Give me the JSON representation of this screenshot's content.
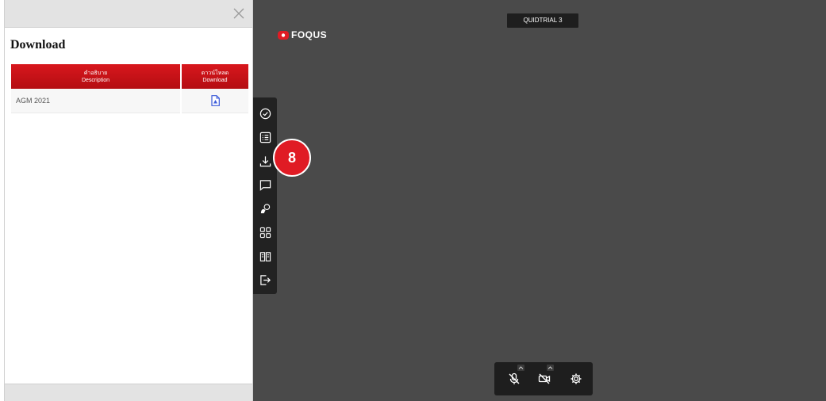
{
  "panel": {
    "title": "Download",
    "close_icon": "close-icon",
    "table": {
      "headers": [
        {
          "th": "คำอธิบาย",
          "en": "Description"
        },
        {
          "th": "ดาวน์โหลด",
          "en": "Download"
        }
      ],
      "rows": [
        {
          "description": "AGM 2021",
          "file_icon": "pdf-file-icon"
        }
      ]
    }
  },
  "video": {
    "logo_text": "FOQUS",
    "meeting_title": "QUIDTRIAL 3",
    "step_badge": "8"
  },
  "toolbar": {
    "items": [
      {
        "name": "vote-icon"
      },
      {
        "name": "agenda-list-icon"
      },
      {
        "name": "download-icon"
      },
      {
        "name": "chat-icon"
      },
      {
        "name": "raise-hand-icon"
      },
      {
        "name": "grid-layout-icon"
      },
      {
        "name": "document-book-icon"
      },
      {
        "name": "exit-icon"
      }
    ]
  },
  "controls": {
    "items": [
      {
        "name": "mic-off-icon"
      },
      {
        "name": "camera-off-icon"
      },
      {
        "name": "settings-icon"
      }
    ]
  },
  "colors": {
    "header_red": "#c8141a",
    "video_bg": "#4a4a4a",
    "toolbar_bg": "#222222",
    "badge_red": "#e01b24",
    "pdf_blue": "#3b5bd9"
  }
}
